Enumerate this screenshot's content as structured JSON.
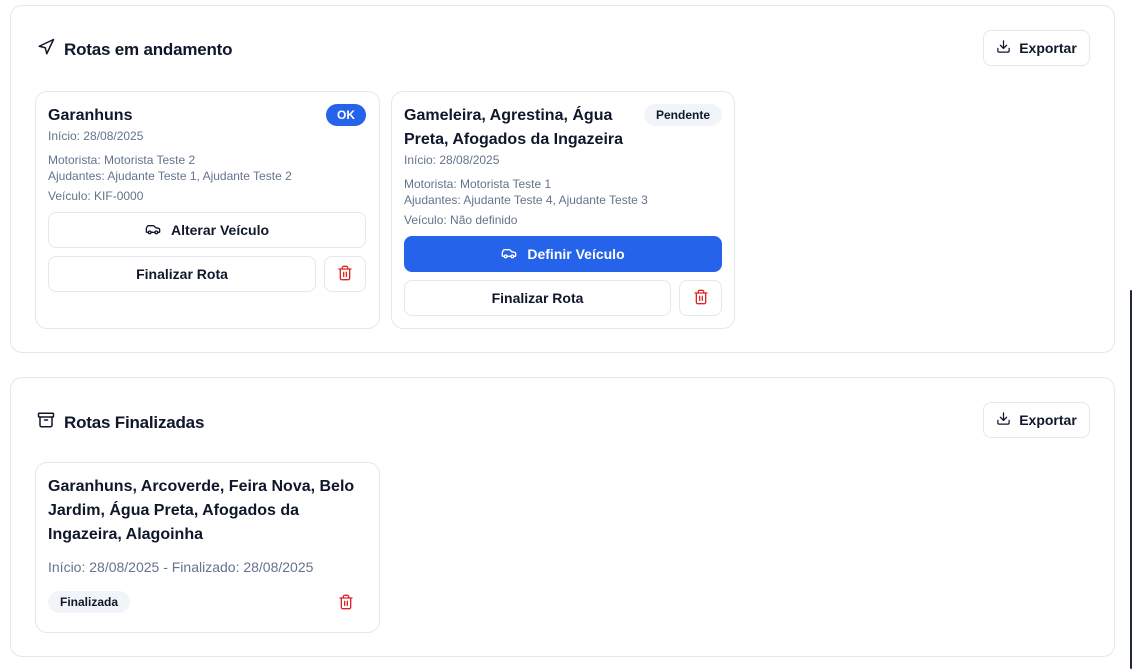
{
  "active_panel": {
    "title": "Rotas em andamento",
    "export_label": "Exportar",
    "cards": [
      {
        "title": "Garanhuns",
        "badge": "OK",
        "start": "Início: 28/08/2025",
        "driver": "Motorista: Motorista Teste 2",
        "helpers": "Ajudantes: Ajudante Teste 1, Ajudante Teste 2",
        "vehicle": "Veículo: KIF-0000",
        "vehicle_button": "Alterar Veículo",
        "finish_button": "Finalizar Rota"
      },
      {
        "title_line1": "Gameleira, Agrestina, Água",
        "title_line2": "Preta, Afogados da Ingazeira",
        "badge": "Pendente",
        "start": "Início: 28/08/2025",
        "driver": "Motorista: Motorista Teste 1",
        "helpers": "Ajudantes: Ajudante Teste 4, Ajudante Teste 3",
        "vehicle": "Veículo: Não definido",
        "vehicle_button": "Definir Veículo",
        "finish_button": "Finalizar Rota"
      }
    ]
  },
  "done_panel": {
    "title": "Rotas Finalizadas",
    "export_label": "Exportar",
    "cards": [
      {
        "title_line1": "Garanhuns, Arcoverde, Feira Nova, Belo",
        "title_line2": "Jardim, Água Preta, Afogados da",
        "title_line3": "Ingazeira, Alagoinha",
        "dates": "Início: 28/08/2025 - Finalizado: 28/08/2025",
        "badge": "Finalizada"
      }
    ]
  },
  "colors": {
    "primary": "#2563eb",
    "danger": "#dc2626",
    "border": "#e2e8f0",
    "muted_text": "#64748b"
  },
  "icons": {
    "active_title": "navigation-arrow-icon",
    "done_title": "archive-box-icon",
    "export": "download-icon",
    "vehicle": "car-icon",
    "delete": "trash-icon"
  }
}
